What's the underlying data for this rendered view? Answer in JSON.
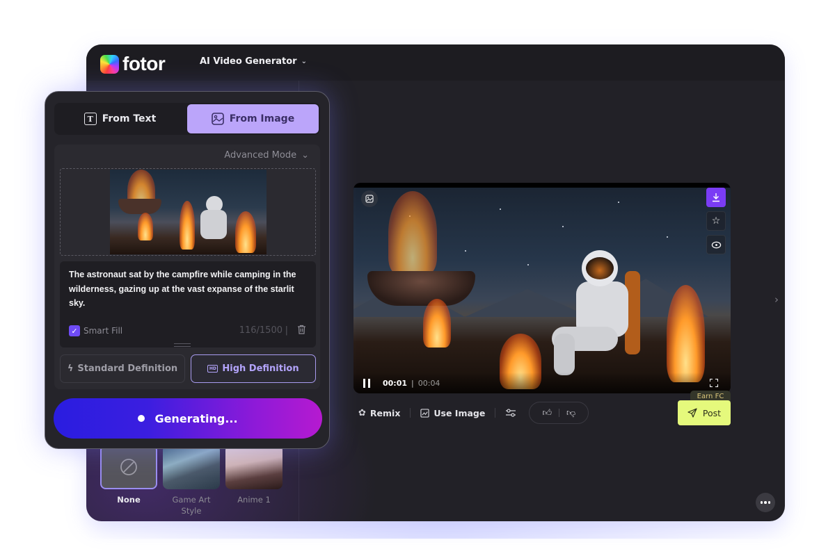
{
  "app": {
    "logo_text": "fotor",
    "nav_title": "AI Video Generator",
    "nav_chevron": "⌄"
  },
  "panel": {
    "tabs": [
      {
        "label": "From Text",
        "icon": "text-icon",
        "glyph": "T",
        "active": false
      },
      {
        "label": "From Image",
        "icon": "image-icon",
        "glyph": "🖼",
        "active": true
      }
    ],
    "advanced_mode_label": "Advanced Mode",
    "prompt_text": "The astronaut sat by the campfire while camping in the wilderness, gazing up at the vast expanse of the starlit sky.",
    "smart_fill_label": "Smart Fill",
    "smart_fill_checked": true,
    "char_count": "116/1500",
    "count_separator": "|",
    "definitions": [
      {
        "label": "Standard Definition",
        "icon": "lightning-icon",
        "glyph": "ϟ",
        "active": false
      },
      {
        "label": "High Definition",
        "icon": "hd-icon",
        "glyph": "HD",
        "active": true
      }
    ],
    "generate_label": "Generating..."
  },
  "styles": [
    {
      "label": "None",
      "active": true
    },
    {
      "label": "Game Art Style",
      "active": false
    },
    {
      "label": "Anime 1",
      "active": false
    }
  ],
  "player": {
    "current_time": "00:01",
    "time_separator": "|",
    "total_time": "00:04",
    "progress_fraction": 0.25
  },
  "actions": {
    "remix_label": "Remix",
    "use_image_label": "Use Image",
    "earn_label": "Earn FC",
    "post_label": "Post"
  },
  "colors": {
    "accent_purple": "#7a3cf5",
    "tab_active": "#bba5fa",
    "post_button": "#e5f97c",
    "generate_gradient_start": "#2a1de0",
    "generate_gradient_end": "#b61ad0"
  }
}
